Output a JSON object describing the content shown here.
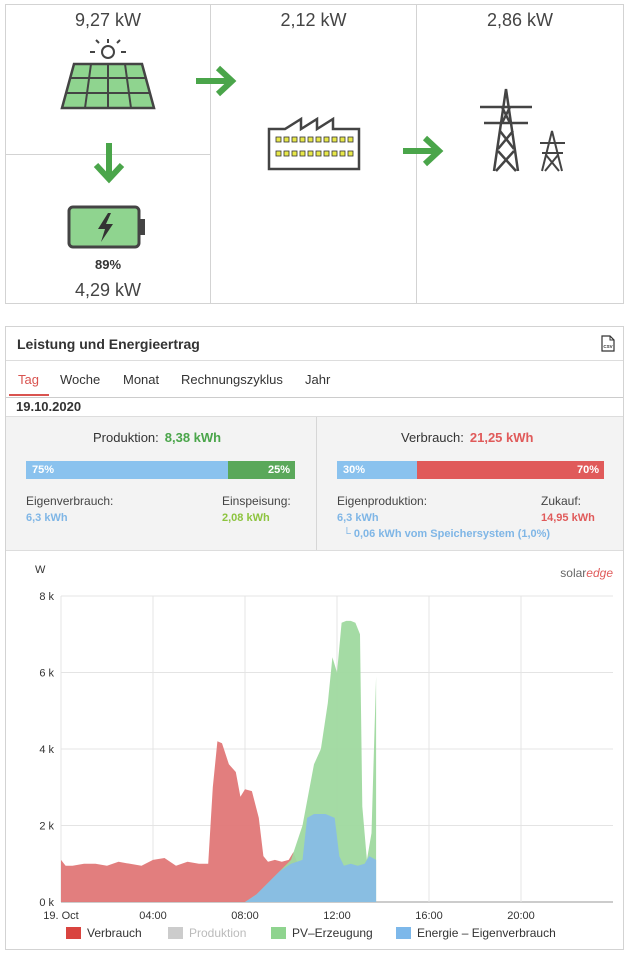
{
  "flow": {
    "pv_kw": "9,27 kW",
    "load_kw": "2,12 kW",
    "grid_kw": "2,86 kW",
    "battery_percent": "89%",
    "battery_kw": "4,29 kW"
  },
  "card": {
    "title": "Leistung und Energieertrag",
    "csv_label": "CSV",
    "tabs": [
      "Tag",
      "Woche",
      "Monat",
      "Rechnungszyklus",
      "Jahr"
    ],
    "date": "19.10.2020"
  },
  "production": {
    "label": "Produktion:",
    "value": "8,38 kWh",
    "self_percent": "75%",
    "export_percent": "25%",
    "self_fraction": 0.75,
    "self_label": "Eigenverbrauch:",
    "self_value": "6,3 kWh",
    "export_label": "Einspeisung:",
    "export_value": "2,08 kWh"
  },
  "consumption": {
    "label": "Verbrauch:",
    "value": "21,25 kWh",
    "own_percent": "30%",
    "purchase_percent": "70%",
    "own_fraction": 0.3,
    "own_label": "Eigenproduktion:",
    "own_value": "6,3 kWh",
    "purchase_label": "Zukauf:",
    "purchase_value": "14,95 kWh",
    "storage_note": "└ 0,06 kWh vom Speichersystem (1,0%)"
  },
  "colors": {
    "green": "#4aa54a",
    "red": "#e05a5a",
    "blue": "#8ac2ee",
    "legend_red": "#d9443f",
    "legend_grey": "#cccccc",
    "legend_green": "#8fd48f",
    "legend_blue": "#7db8ea"
  },
  "chart_data": {
    "type": "area",
    "ylabel": "W",
    "brand": {
      "solar": "solar",
      "edge": "edge"
    },
    "ylim": [
      0,
      8000
    ],
    "yticks": [
      {
        "value": 0,
        "label": "0 k"
      },
      {
        "value": 2000,
        "label": "2 k"
      },
      {
        "value": 4000,
        "label": "4 k"
      },
      {
        "value": 6000,
        "label": "6 k"
      },
      {
        "value": 8000,
        "label": "8 k"
      }
    ],
    "xlim": [
      0,
      24
    ],
    "xticks": [
      {
        "value": 0,
        "label": "19. Oct"
      },
      {
        "value": 4,
        "label": "04:00"
      },
      {
        "value": 8,
        "label": "08:00"
      },
      {
        "value": 12,
        "label": "12:00"
      },
      {
        "value": 16,
        "label": "16:00"
      },
      {
        "value": 20,
        "label": "20:00"
      }
    ],
    "grid": true,
    "legend_placement": "bottom",
    "series": [
      {
        "name": "Verbrauch",
        "x": [
          0,
          0.2,
          0.5,
          1.0,
          1.5,
          2.0,
          2.5,
          3.0,
          3.5,
          4.0,
          4.5,
          5.0,
          5.5,
          6.0,
          6.4,
          6.6,
          6.8,
          7.0,
          7.3,
          7.6,
          7.8,
          8.0,
          8.3,
          8.6,
          8.8,
          9.0,
          9.3,
          9.6,
          9.9,
          10.1,
          10.3
        ],
        "y": [
          1100,
          950,
          950,
          1000,
          1000,
          950,
          1050,
          1000,
          950,
          1100,
          1150,
          950,
          1050,
          1000,
          1000,
          3000,
          4200,
          4150,
          3600,
          3400,
          2750,
          2950,
          2900,
          2200,
          1200,
          1050,
          1100,
          1050,
          1100,
          1300,
          1000
        ],
        "color": "#e07777"
      },
      {
        "name": "PV–Erzeugung",
        "x": [
          8.0,
          8.5,
          9.0,
          9.5,
          10.0,
          10.5,
          11.0,
          11.3,
          11.6,
          11.8,
          12.0,
          12.2,
          12.4,
          12.6,
          12.8,
          13.0,
          13.1,
          13.3,
          13.5,
          13.7,
          13.7
        ],
        "y": [
          0,
          200,
          500,
          800,
          1100,
          2000,
          3600,
          4000,
          5200,
          6400,
          6000,
          7300,
          7350,
          7350,
          7300,
          7000,
          2500,
          1100,
          1800,
          5900,
          0
        ],
        "color": "#9fd99f"
      },
      {
        "name": "Energie – Eigenverbrauch",
        "x": [
          8.0,
          8.5,
          9.0,
          9.5,
          10.0,
          10.5,
          10.7,
          11.0,
          11.5,
          11.9,
          12.1,
          12.3,
          12.6,
          12.9,
          13.2,
          13.4,
          13.7,
          13.7
        ],
        "y": [
          0,
          200,
          500,
          800,
          1000,
          1100,
          2200,
          2300,
          2300,
          2200,
          1200,
          950,
          1000,
          950,
          1000,
          1200,
          1100,
          0
        ],
        "color": "#88bde6"
      }
    ],
    "legend": [
      {
        "name": "Verbrauch",
        "color": "#d9443f",
        "muted": false
      },
      {
        "name": "Produktion",
        "color": "#cccccc",
        "muted": true
      },
      {
        "name": "PV–Erzeugung",
        "color": "#8fd48f",
        "muted": false
      },
      {
        "name": "Energie – Eigenverbrauch",
        "color": "#7db8ea",
        "muted": false
      }
    ]
  }
}
